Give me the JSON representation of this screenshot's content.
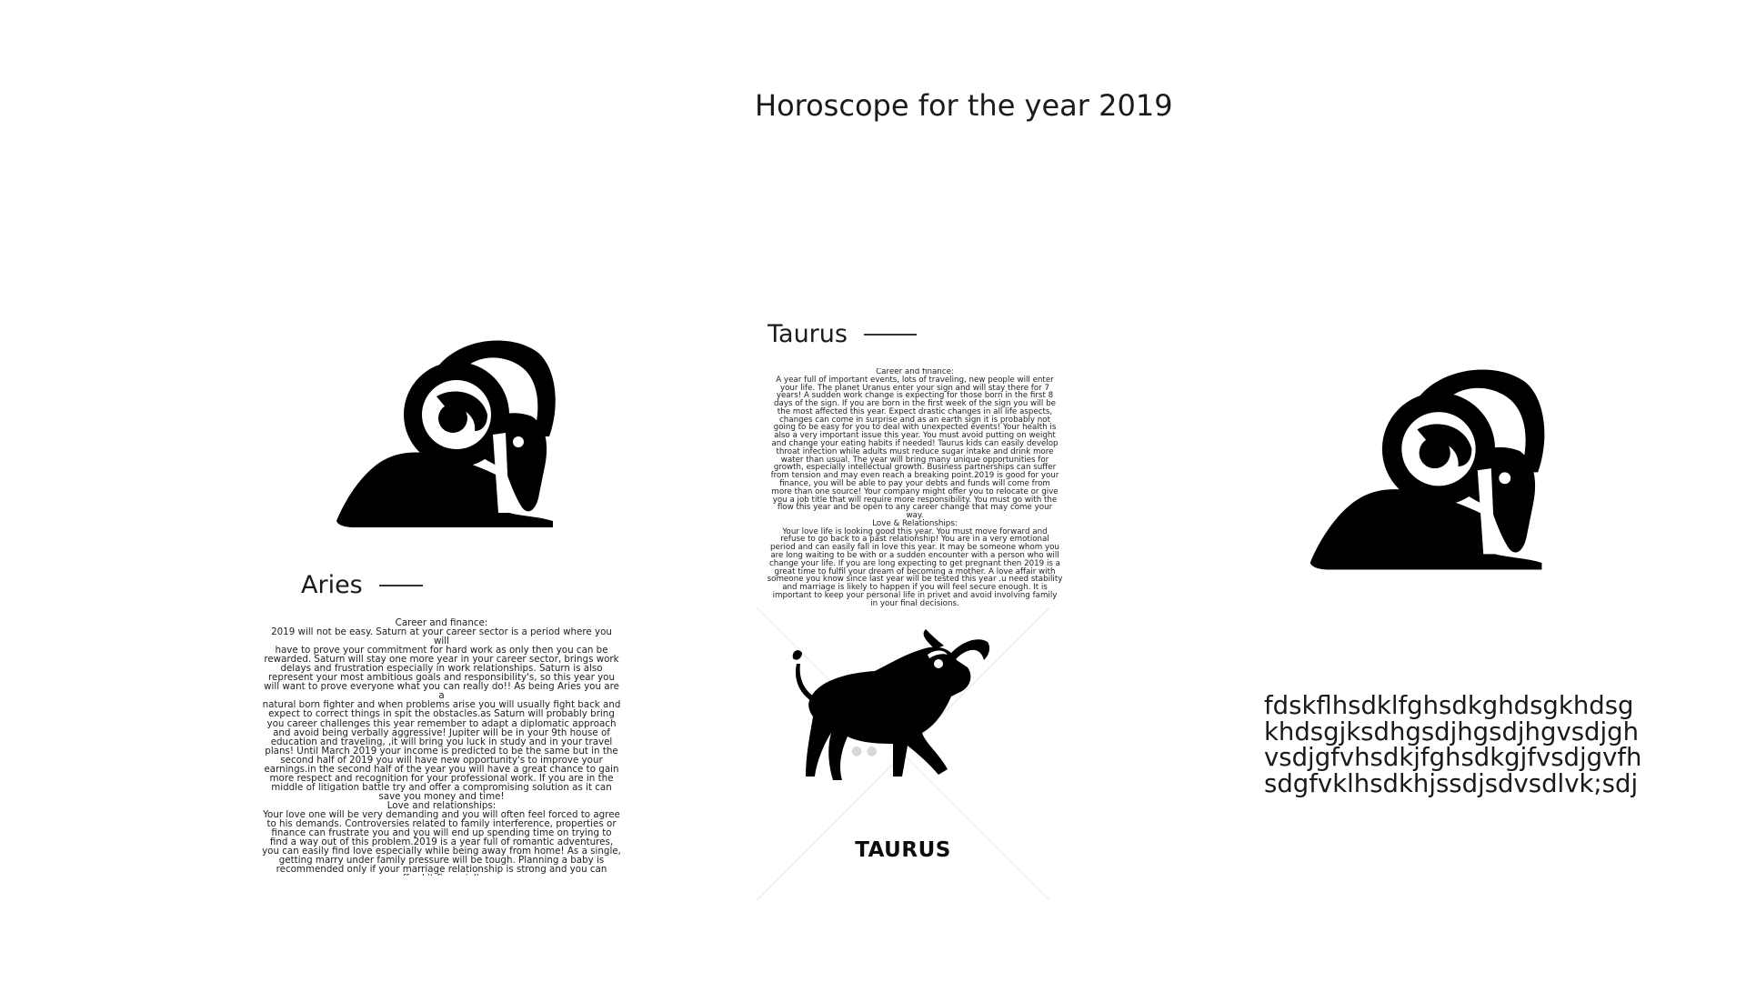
{
  "page": {
    "title": "Horoscope for the year 2019"
  },
  "aries": {
    "heading": "Aries",
    "body": "Career and finance:\n2019 will not be easy. Saturn at your career sector is a period where you will\nhave to prove your commitment for hard work as only then you can be\nrewarded.  Saturn will stay one more year in your career sector, brings work\ndelays and frustration especially in work relationships. Saturn is also\nrepresent your most ambitious goals and responsibility's, so this year you\nwill want to prove everyone what you can really do!! As being Aries you are a\nnatural born fighter and when problems arise you will usually fight back and\nexpect to correct things in spit the obstacles.as Saturn will probably bring\nyou career challenges this year remember to adapt a diplomatic approach\nand avoid being verbally aggressive! Jupiter will be in your 9th house of\neducation and traveling, ,it will bring you luck in study and in your travel\nplans! Until March 2019 your income is predicted to be the same but in the\nsecond half of 2019 you will have new opportunity's to improve your\nearnings.in the second half of the year you will have a great chance to gain\nmore respect and recognition for your professional work. If you are in the\nmiddle of litigation battle try and offer a compromising solution as it can\nsave you money and time!\nLove and relationships:\nYour love one will be very demanding and you will often feel forced to agree\nto his demands. Controversies related to family interference, properties or\nfinance can frustrate you and you will end up spending time on trying to\nfind a way out of this problem.2019 is a  year full of romantic adventures,\nyou can easily find love especially while being away from home! As a single,\ngetting marry under family pressure will be tough. Planning a baby is\nrecommended only if your marriage relationship is strong and you can\nafford it financially."
  },
  "taurus": {
    "heading": "Taurus",
    "body": "Career and finance:\nA year full of important events, lots of traveling, new people will enter\nyour life. The planet Uranus enter your sign and will stay there for 7\nyears! A sudden work change is expecting for those born in the first 8\ndays of the sign. If you are born in the first week of the sign you will be\nthe most affected this year. Expect drastic changes in all life aspects,\nchanges can come in surprise and as an earth sign it is probably not\ngoing to be easy for you to deal with unexpected events! Your health is\nalso a very important issue this year. You must avoid putting on weight\nand change your eating habits if needed! Taurus kids can easily develop\nthroat infection while adults must reduce sugar intake and drink more\nwater than usual. The year will bring  many unique opportunities for\ngrowth, especially intellectual growth. Business partnerships can suffer\nfrom tension and may even reach a breaking point.2019 is good for your\nfinance, you will be able to pay your debts and funds will come from\nmore than one source! Your company might offer you to relocate or give\nyou a job title that will require more responsibility. You must go with the\nflow this year and be open  to any career change that may come your\nway.\nLove & Relationships:\nYour love life is looking good this year. You must move forward and\nrefuse to go back to a past relationship! You are in a very emotional\nperiod and can easily fall in love this year. It may be someone whom you\nare long waiting to be with or a sudden encounter with a person who will\nchange your life. If you are long expecting to get pregnant then 2019 is a\ngreat time to fulfil your dream of becoming a mother. A love affair with\nsomeone you know since last year will be tested this year .u need stability\nand marriage is likely to happen if you will feel secure enough. It is\nimportant to keep your personal life in privet and avoid involving family\nin your  final decisions.",
    "card_label": "TAURUS"
  },
  "placeholder_text": "fdskflhsdklfghsdkghdsgkhdsg\nkhdsgjksdhgsdjhgsdjhgvsdjgh\nvsdjgfvhsdkjfghsdkgjfvsdjgvfh\nsdgfvklhsdkhjssdjsdvsdlvk;sdj",
  "images": {
    "ram_left": "ram-silhouette-icon",
    "ram_right": "ram-silhouette-icon",
    "bull": "bull-silhouette-icon"
  }
}
